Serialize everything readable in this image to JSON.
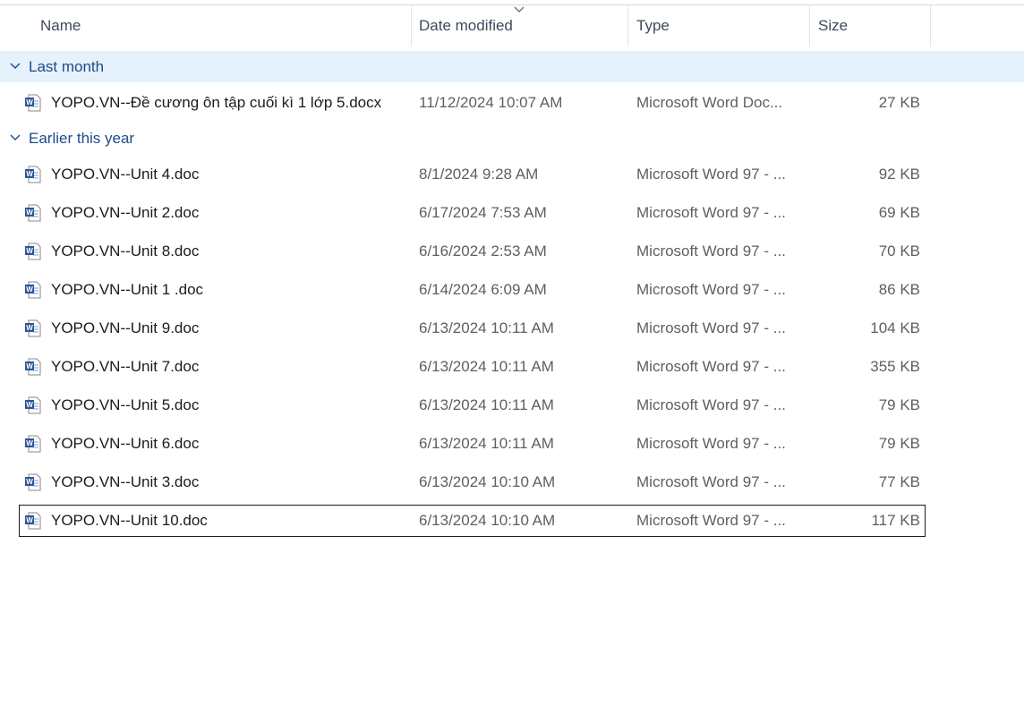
{
  "columns": {
    "name": "Name",
    "date_modified": "Date modified",
    "type": "Type",
    "size": "Size"
  },
  "groups": [
    {
      "label": "Last month",
      "files": [
        {
          "name": "YOPO.VN--Đề cương ôn tập cuối kì 1 lớp 5.docx",
          "date": "11/12/2024 10:07 AM",
          "type": "Microsoft Word Doc...",
          "size": "27 KB"
        }
      ]
    },
    {
      "label": "Earlier this year",
      "files": [
        {
          "name": "YOPO.VN--Unit 4.doc",
          "date": "8/1/2024 9:28 AM",
          "type": "Microsoft Word 97 - ...",
          "size": "92 KB"
        },
        {
          "name": "YOPO.VN--Unit 2.doc",
          "date": "6/17/2024 7:53 AM",
          "type": "Microsoft Word 97 - ...",
          "size": "69 KB"
        },
        {
          "name": "YOPO.VN--Unit 8.doc",
          "date": "6/16/2024 2:53 AM",
          "type": "Microsoft Word 97 - ...",
          "size": "70 KB"
        },
        {
          "name": "YOPO.VN--Unit 1 .doc",
          "date": "6/14/2024 6:09 AM",
          "type": "Microsoft Word 97 - ...",
          "size": "86 KB"
        },
        {
          "name": "YOPO.VN--Unit 9.doc",
          "date": "6/13/2024 10:11 AM",
          "type": "Microsoft Word 97 - ...",
          "size": "104 KB"
        },
        {
          "name": "YOPO.VN--Unit 7.doc",
          "date": "6/13/2024 10:11 AM",
          "type": "Microsoft Word 97 - ...",
          "size": "355 KB"
        },
        {
          "name": "YOPO.VN--Unit 5.doc",
          "date": "6/13/2024 10:11 AM",
          "type": "Microsoft Word 97 - ...",
          "size": "79 KB"
        },
        {
          "name": "YOPO.VN--Unit 6.doc",
          "date": "6/13/2024 10:11 AM",
          "type": "Microsoft Word 97 - ...",
          "size": "79 KB"
        },
        {
          "name": "YOPO.VN--Unit 3.doc",
          "date": "6/13/2024 10:10 AM",
          "type": "Microsoft Word 97 - ...",
          "size": "77 KB"
        },
        {
          "name": "YOPO.VN--Unit 10.doc",
          "date": "6/13/2024 10:10 AM",
          "type": "Microsoft Word 97 - ...",
          "size": "117 KB"
        }
      ]
    }
  ],
  "icons": {
    "file": "word-document-icon",
    "group_toggle": "chevron-down-icon",
    "sort": "sort-indicator-icon"
  },
  "colors": {
    "group_header_text": "#1e4b8c",
    "group_highlight": "#e5f1fb",
    "word_blue": "#2b579a"
  }
}
